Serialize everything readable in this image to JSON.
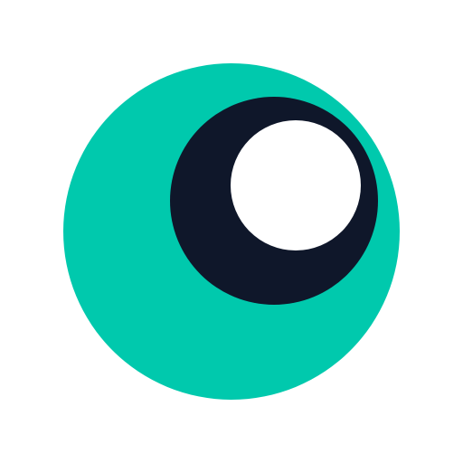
{
  "logo": {
    "icon": "eye-logo-icon",
    "background_color": "#FFFFFF",
    "outer_circle_color": "#00C9AD",
    "pupil_color": "#0F172A",
    "highlight_color": "#FFFFFF"
  }
}
